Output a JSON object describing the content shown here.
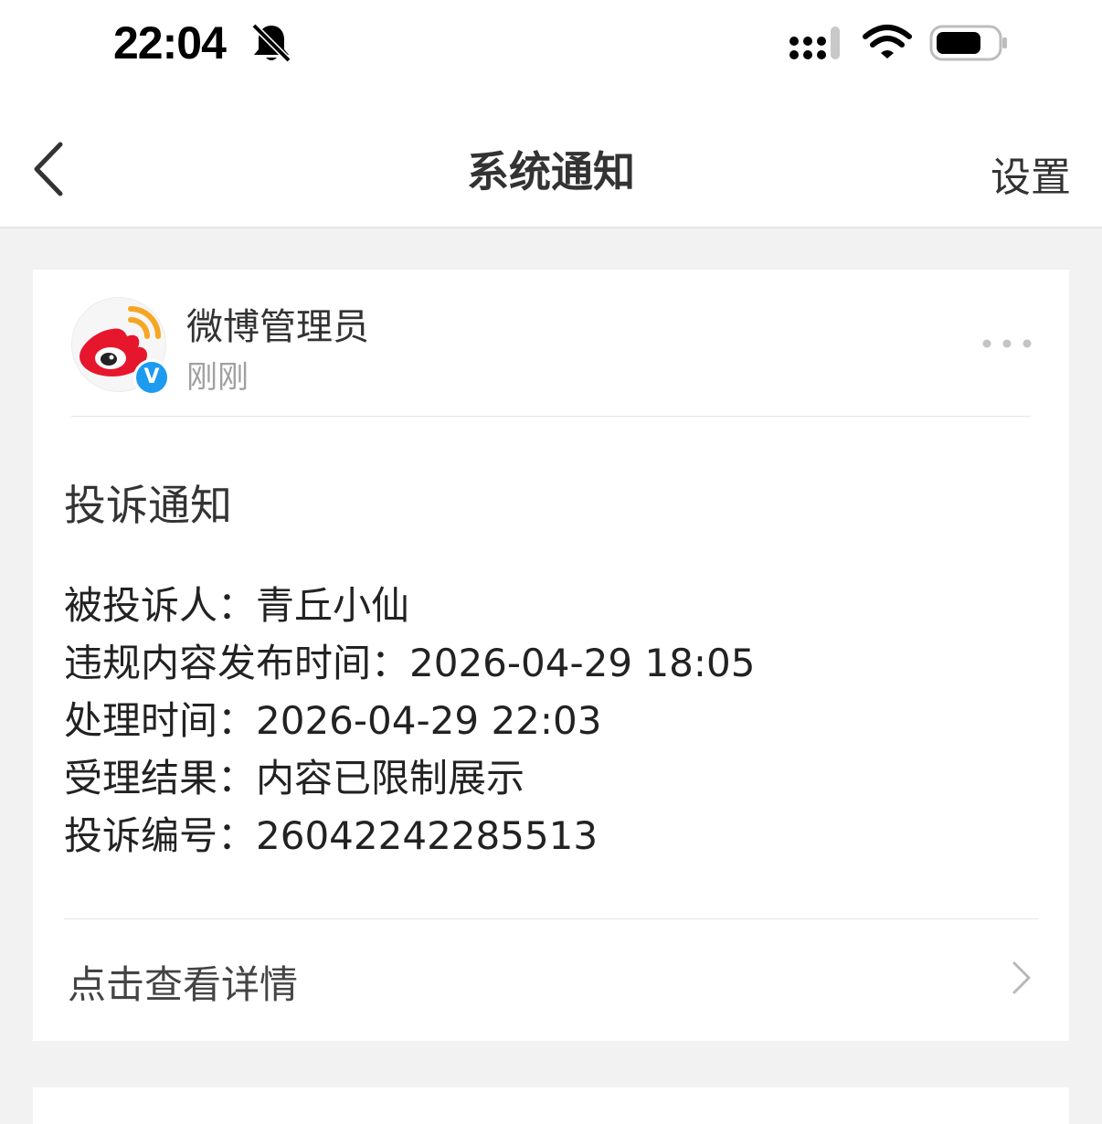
{
  "status_bar": {
    "time": "22:04",
    "icons": [
      "bell-slash-icon",
      "cellular-signal-icon",
      "wifi-icon",
      "battery-icon"
    ]
  },
  "nav": {
    "title": "系统通知",
    "right_label": "设置",
    "back_icon": "chevron-left-icon"
  },
  "notification": {
    "sender": "微博管理员",
    "time": "刚刚",
    "verified_mark": "V",
    "title": "投诉通知",
    "details": [
      {
        "label": "被投诉人：",
        "value": "青丘小仙"
      },
      {
        "label": "违规内容发布时间：",
        "value": "2026-04-29 18:05"
      },
      {
        "label": "处理时间：",
        "value": "2026-04-29 22:03"
      },
      {
        "label": "受理结果：",
        "value": "内容已限制展示"
      },
      {
        "label": "投诉编号：",
        "value": "26042242285513"
      }
    ],
    "view_details_label": "点击查看详情"
  },
  "colors": {
    "background": "#f2f2f2",
    "card": "#ffffff",
    "weibo_red": "#e6162d",
    "weibo_orange": "#f5a623",
    "verified_blue": "#1d9bf0"
  }
}
